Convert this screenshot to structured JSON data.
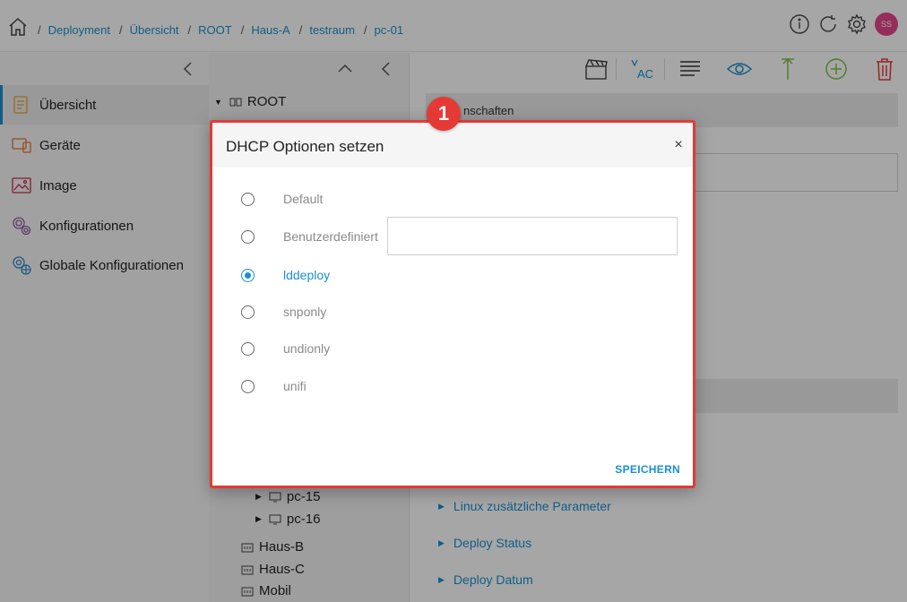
{
  "breadcrumb": {
    "items": [
      "Deployment",
      "Übersicht",
      "ROOT",
      "Haus-A",
      "testraum",
      "pc-01"
    ],
    "separator": "/"
  },
  "header": {
    "avatar_initials": "SS"
  },
  "sidebar": {
    "items": [
      {
        "label": "Übersicht",
        "icon": "overview-icon",
        "active": true
      },
      {
        "label": "Geräte",
        "icon": "devices-icon"
      },
      {
        "label": "Image",
        "icon": "image-icon"
      },
      {
        "label": "Konfigurationen",
        "icon": "configurations-icon"
      },
      {
        "label": "Globale Konfigurationen",
        "icon": "global-configurations-icon"
      }
    ]
  },
  "tree": {
    "root": "ROOT",
    "nodes": [
      "pc-15",
      "pc-16"
    ],
    "groups": [
      "Haus-B",
      "Haus-C",
      "Mobil"
    ]
  },
  "main": {
    "section_title_partial": "nschaften",
    "accordions": [
      "Linux zusätzliche Parameter",
      "Deploy Status",
      "Deploy Datum"
    ]
  },
  "dialog": {
    "title": "DHCP Optionen setzen",
    "close_glyph": "×",
    "options": [
      {
        "label": "Default",
        "checked": false
      },
      {
        "label": "Benutzerdefiniert",
        "checked": false
      },
      {
        "label": "lddeploy",
        "checked": true
      },
      {
        "label": "snponly",
        "checked": false
      },
      {
        "label": "undionly",
        "checked": false
      },
      {
        "label": "unifi",
        "checked": false
      }
    ],
    "custom_value": "",
    "save_label": "SPEICHERN"
  },
  "step_badge": "1",
  "colors": {
    "accent": "#1a8fd0",
    "highlight": "#e53935",
    "avatar": "#e2488a",
    "add": "#7cc142",
    "delete": "#e53935"
  }
}
